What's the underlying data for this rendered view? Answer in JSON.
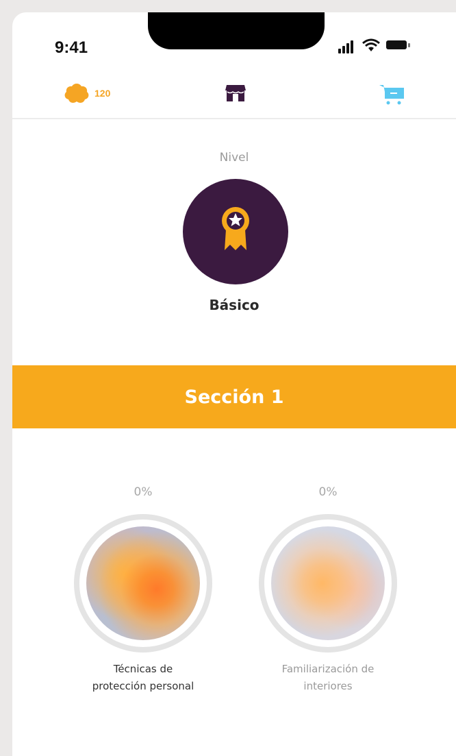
{
  "status": {
    "time": "9:41"
  },
  "topbar": {
    "coins": "120",
    "icons": [
      "coin-icon",
      "store-icon",
      "cart-icon"
    ]
  },
  "level": {
    "label": "Nivel",
    "name": "Básico",
    "icon": "ribbon-medal-icon"
  },
  "section": {
    "title": "Sección 1"
  },
  "courses": [
    {
      "progress": "0%",
      "title": "Técnicas de protección personal",
      "lines": [
        "Técnicas de",
        "protección personal"
      ],
      "locked": false
    },
    {
      "progress": "0%",
      "title": "Familiarización de interiores",
      "lines": [
        "Familiarización de",
        "interiores"
      ],
      "locked": true
    }
  ],
  "colors": {
    "accent": "#f7a91c",
    "badge_bg": "#3b1a40",
    "cart": "#5bc8f0"
  }
}
